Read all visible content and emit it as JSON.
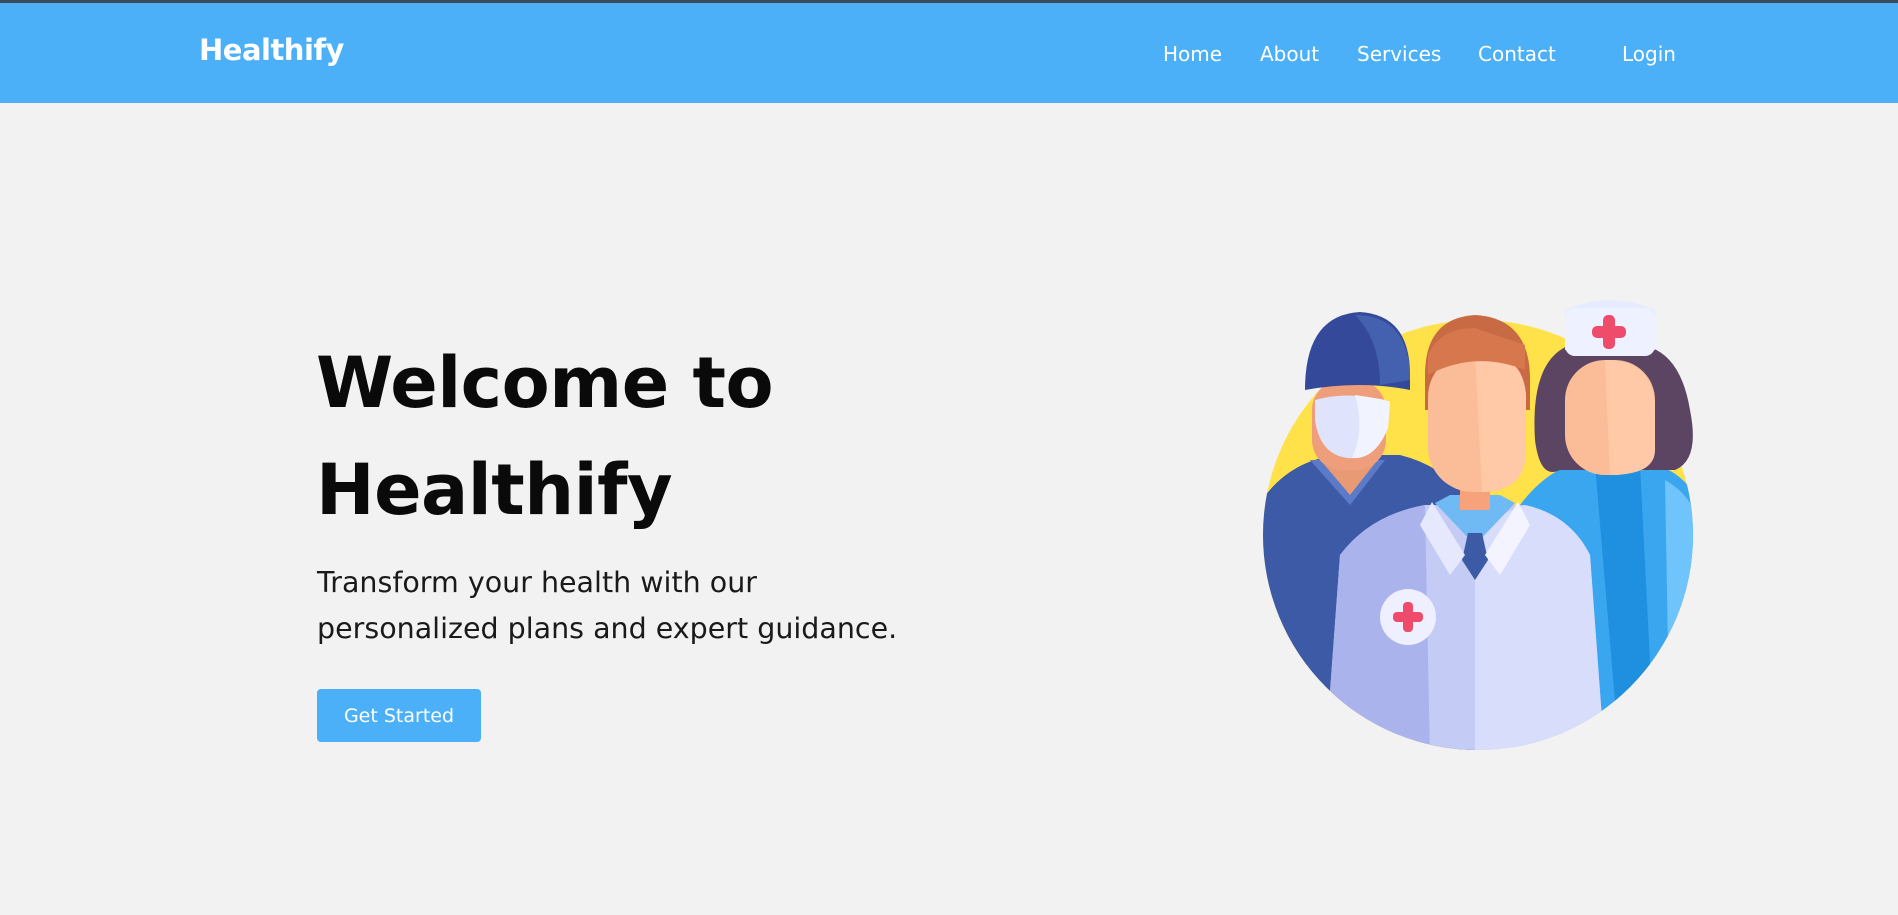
{
  "header": {
    "brand": "Healthify",
    "nav": {
      "home": "Home",
      "about": "About",
      "services": "Services",
      "contact": "Contact",
      "login": "Login"
    }
  },
  "hero": {
    "title_line1": "Welcome to",
    "title_line2": "Healthify",
    "subtitle_line1": "Transform your health with our",
    "subtitle_line2": "personalized plans and expert guidance.",
    "cta_label": "Get Started"
  },
  "colors": {
    "brand_blue": "#4bb0f7",
    "page_background": "#f2f2f2",
    "illustration_accent": "#ffe24a"
  },
  "icons": {
    "hero_image": "medical-staff-illustration"
  }
}
